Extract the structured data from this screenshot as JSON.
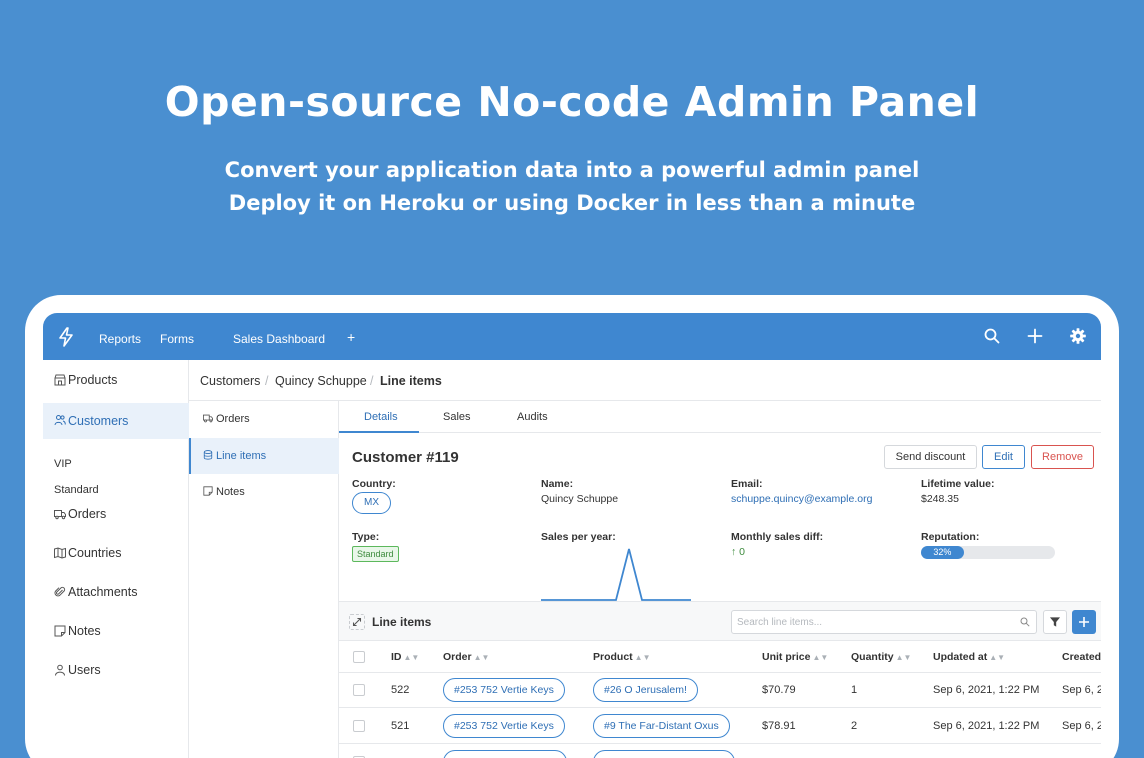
{
  "hero": {
    "title": "Open-source No-code Admin Panel",
    "line1": "Convert your application data into a powerful admin panel",
    "line2": "Deploy it on Heroku or using Docker in less than a minute"
  },
  "topbar": {
    "nav": [
      "Reports",
      "Forms",
      "Sales Dashboard"
    ],
    "add_symbol": "+"
  },
  "sidebar": {
    "items": [
      {
        "label": "Products",
        "icon": "store-icon"
      },
      {
        "label": "Customers",
        "icon": "users-icon"
      },
      {
        "label": "Orders",
        "icon": "truck-icon"
      },
      {
        "label": "Countries",
        "icon": "map-icon"
      },
      {
        "label": "Attachments",
        "icon": "paperclip-icon"
      },
      {
        "label": "Notes",
        "icon": "note-icon"
      },
      {
        "label": "Users",
        "icon": "user-icon"
      }
    ],
    "customer_subitems": [
      "VIP",
      "Standard"
    ]
  },
  "breadcrumb": [
    "Customers",
    "Quincy Schuppe",
    "Line items"
  ],
  "subnav": [
    "Orders",
    "Line items",
    "Notes"
  ],
  "tabs": [
    "Details",
    "Sales",
    "Audits"
  ],
  "detail": {
    "title": "Customer #119",
    "buttons": {
      "send_discount": "Send discount",
      "edit": "Edit",
      "remove": "Remove"
    },
    "country_label": "Country:",
    "country_value": "MX",
    "name_label": "Name:",
    "name_value": "Quincy Schuppe",
    "email_label": "Email:",
    "email_value": "schuppe.quincy@example.org",
    "lifetime_label": "Lifetime value:",
    "lifetime_value": "$248.35",
    "type_label": "Type:",
    "type_value": "Standard",
    "sales_label": "Sales per year:",
    "monthly_label": "Monthly sales diff:",
    "monthly_value": "↑ 0",
    "reputation_label": "Reputation:",
    "reputation_value": "32%",
    "reputation_fraction": 0.32
  },
  "line_items": {
    "title": "Line items",
    "search_placeholder": "Search line items..."
  },
  "table": {
    "columns": [
      "ID",
      "Order",
      "Product",
      "Unit price",
      "Quantity",
      "Updated at",
      "Created"
    ],
    "rows": [
      {
        "id": "522",
        "order": "#253 752 Vertie Keys",
        "product": "#26 O Jerusalem!",
        "price": "$70.79",
        "qty": "1",
        "updated": "Sep 6, 2021, 1:22 PM",
        "created": "Sep 6, 2"
      },
      {
        "id": "521",
        "order": "#253 752 Vertie Keys",
        "product": "#9 The Far-Distant Oxus",
        "price": "$78.91",
        "qty": "2",
        "updated": "Sep 6, 2021, 1:22 PM",
        "created": "Sep 6, 2"
      }
    ]
  },
  "colors": {
    "accent": "#3f87d0",
    "background": "#4a8fd0",
    "remove": "#d9534f",
    "tag_green": "#5cb85c"
  }
}
